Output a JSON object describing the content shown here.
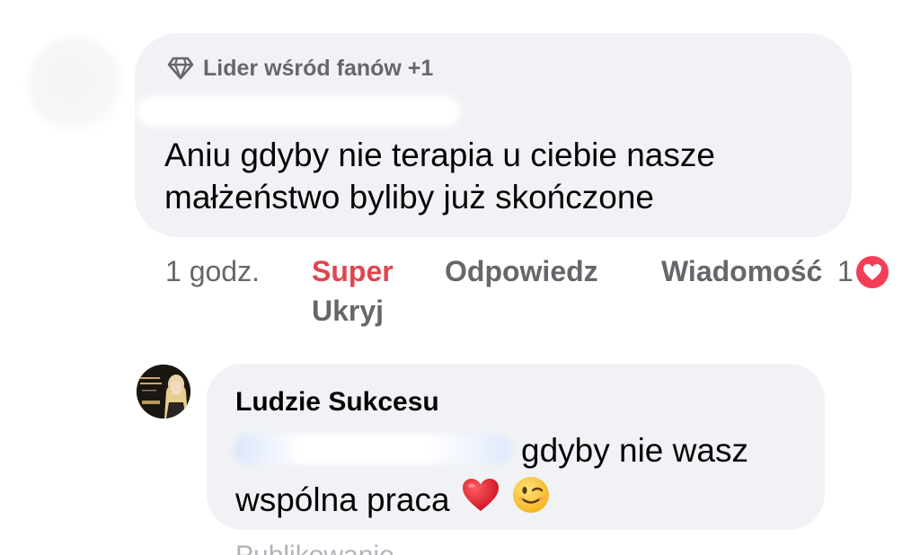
{
  "comment": {
    "badge": "Lider wśród fanów +1",
    "text": "Aniu gdyby nie terapia u ciebie nasze małżeństwo byliby już skończone",
    "time": "1 godz.",
    "actions": {
      "react": "Super",
      "reply": "Odpowiedz",
      "message": "Wiadomość",
      "hide": "Ukryj"
    },
    "reaction_count": "1",
    "reaction_icon": "heart-icon",
    "reaction_color": "#f33e58"
  },
  "reply": {
    "author": "Ludzie Sukcesu",
    "text_line1": "gdyby nie wasz",
    "text_line2": "wspólna praca",
    "emojis": [
      "red-heart-emoji",
      "winking-face-emoji"
    ]
  },
  "cutoff": "Publikowanie...",
  "colors": {
    "bubble": "#f0f2f5",
    "secondary_text": "#65676b",
    "super_red": "#e0444f",
    "primary_text": "#050505"
  }
}
